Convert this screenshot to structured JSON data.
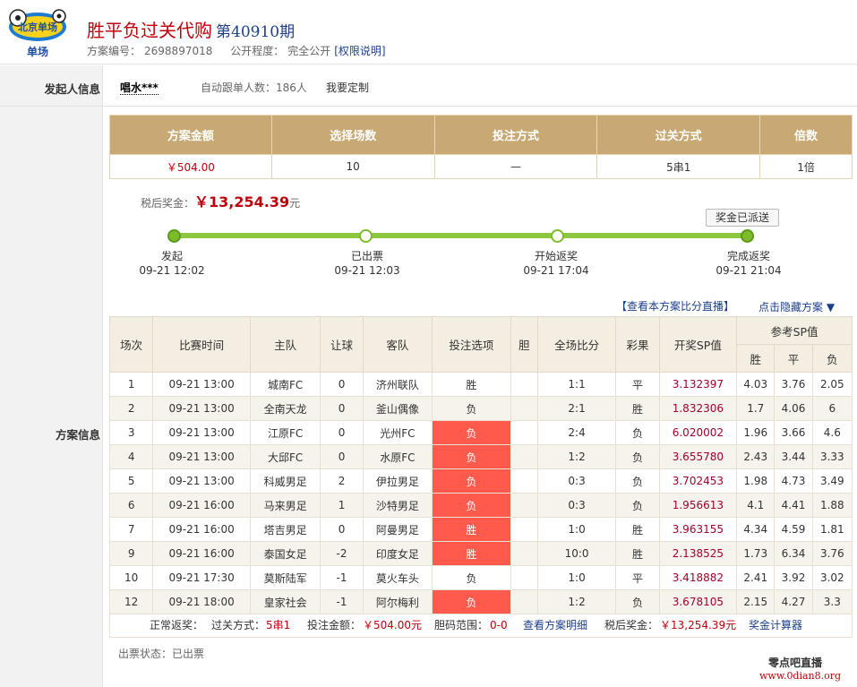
{
  "header": {
    "title": "胜平负过关代购",
    "issue": "第40910期",
    "plan_no_label": "方案编号：",
    "plan_no": "2698897018",
    "public_label": "公开程度：",
    "public_value": "完全公开",
    "rights_link": "[权限说明]",
    "logo_text": "单场",
    "logo_badge": "北京单场"
  },
  "sponsor": {
    "label": "发起人信息",
    "name": "唱水***",
    "auto_follow": "自动跟单人数：186人",
    "custom": "我要定制"
  },
  "summary": {
    "headers": [
      "方案金额",
      "选择场数",
      "投注方式",
      "过关方式",
      "倍数"
    ],
    "values": [
      "￥504.00",
      "10",
      "—",
      "5串1",
      "1倍"
    ]
  },
  "prize": {
    "label": "税后奖金：",
    "amount": "￥13,254.39",
    "unit": "元"
  },
  "progress": {
    "sent_button": "奖金已派送",
    "steps": [
      {
        "name": "发起",
        "time": "09-21 12:02"
      },
      {
        "name": "已出票",
        "time": "09-21 12:03"
      },
      {
        "name": "开始返奖",
        "time": "09-21 17:04"
      },
      {
        "name": "完成返奖",
        "time": "09-21 21:04"
      }
    ]
  },
  "links": {
    "live": "【查看本方案比分直播】",
    "hide": "点击隐藏方案 ▼"
  },
  "plan_label": "方案信息",
  "detail": {
    "headers": [
      "场次",
      "比赛时间",
      "主队",
      "让球",
      "客队",
      "投注选项",
      "胆",
      "全场比分",
      "彩果",
      "开奖SP值"
    ],
    "ref_header": "参考SP值",
    "ref_sub": [
      "胜",
      "平",
      "负"
    ],
    "rows": [
      {
        "no": "1",
        "time": "09-21 13:00",
        "home": "城南FC",
        "hc": "0",
        "away": "济州联队",
        "pick": "胜",
        "hot": false,
        "banker": "",
        "score": "1:1",
        "result": "平",
        "sp": "3.132397",
        "w": "4.03",
        "d": "3.76",
        "l": "2.05"
      },
      {
        "no": "2",
        "time": "09-21 13:00",
        "home": "全南天龙",
        "hc": "0",
        "away": "釜山偶像",
        "pick": "负",
        "hot": false,
        "banker": "",
        "score": "2:1",
        "result": "胜",
        "sp": "1.832306",
        "w": "1.7",
        "d": "4.06",
        "l": "6"
      },
      {
        "no": "3",
        "time": "09-21 13:00",
        "home": "江原FC",
        "hc": "0",
        "away": "光州FC",
        "pick": "负",
        "hot": true,
        "banker": "",
        "score": "2:4",
        "result": "负",
        "sp": "6.020002",
        "w": "1.96",
        "d": "3.66",
        "l": "4.6"
      },
      {
        "no": "4",
        "time": "09-21 13:00",
        "home": "大邱FC",
        "hc": "0",
        "away": "水原FC",
        "pick": "负",
        "hot": true,
        "banker": "",
        "score": "1:2",
        "result": "负",
        "sp": "3.655780",
        "w": "2.43",
        "d": "3.44",
        "l": "3.33"
      },
      {
        "no": "5",
        "time": "09-21 13:00",
        "home": "科威男足",
        "hc": "2",
        "away": "伊拉男足",
        "pick": "负",
        "hot": true,
        "banker": "",
        "score": "0:3",
        "result": "负",
        "sp": "3.702453",
        "w": "1.98",
        "d": "4.73",
        "l": "3.49"
      },
      {
        "no": "6",
        "time": "09-21 16:00",
        "home": "马来男足",
        "hc": "1",
        "away": "沙特男足",
        "pick": "负",
        "hot": true,
        "banker": "",
        "score": "0:3",
        "result": "负",
        "sp": "1.956613",
        "w": "4.1",
        "d": "4.41",
        "l": "1.88"
      },
      {
        "no": "7",
        "time": "09-21 16:00",
        "home": "塔吉男足",
        "hc": "0",
        "away": "阿曼男足",
        "pick": "胜",
        "hot": true,
        "banker": "",
        "score": "1:0",
        "result": "胜",
        "sp": "3.963155",
        "w": "4.34",
        "d": "4.59",
        "l": "1.81"
      },
      {
        "no": "9",
        "time": "09-21 16:00",
        "home": "泰国女足",
        "hc": "-2",
        "away": "印度女足",
        "pick": "胜",
        "hot": true,
        "banker": "",
        "score": "10:0",
        "result": "胜",
        "sp": "2.138525",
        "w": "1.73",
        "d": "6.34",
        "l": "3.76"
      },
      {
        "no": "10",
        "time": "09-21 17:30",
        "home": "莫斯陆军",
        "hc": "-1",
        "away": "莫火车头",
        "pick": "负",
        "hot": false,
        "banker": "",
        "score": "1:0",
        "result": "平",
        "sp": "3.418882",
        "w": "2.41",
        "d": "3.92",
        "l": "3.02"
      },
      {
        "no": "12",
        "time": "09-21 18:00",
        "home": "皇家社会",
        "hc": "-1",
        "away": "阿尔梅利",
        "pick": "负",
        "hot": true,
        "banker": "",
        "score": "1:2",
        "result": "负",
        "sp": "3.678105",
        "w": "2.15",
        "d": "4.27",
        "l": "3.3"
      }
    ]
  },
  "footer": {
    "normal": "正常返奖：",
    "pass_label": "过关方式：",
    "pass_value": "5串1",
    "amount_label": "投注金额：",
    "amount_value": "￥504.00元",
    "range_label": "胆码范围：",
    "range_value": "0-0",
    "detail_link": "查看方案明细",
    "after_tax_label": "税后奖金：",
    "after_tax_value": "￥13,254.39元",
    "calc_link": "奖金计算器"
  },
  "status": "出票状态：已出票",
  "watermark": {
    "line1": "零点吧直播",
    "line2": "www.0dian8.org"
  },
  "colors": {
    "header_gold": "#c8a873",
    "hot_red": "#ff5a4c",
    "progress_green": "#8dc63f",
    "title_red": "#c0000a",
    "link_blue": "#1c3f8c"
  }
}
